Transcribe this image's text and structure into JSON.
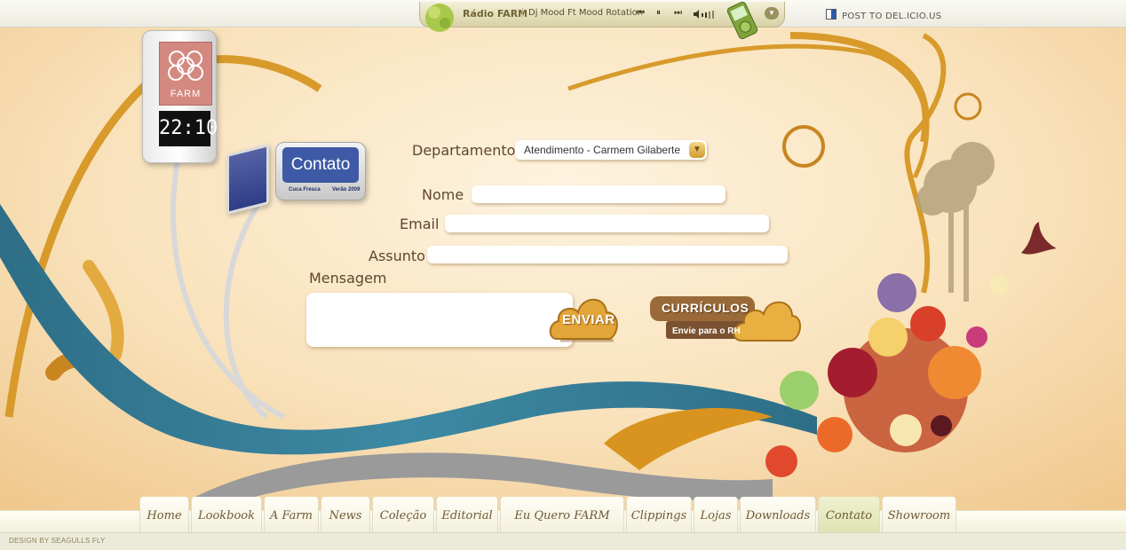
{
  "radio": {
    "title": "Rádio FARM",
    "track": "Dj Mood Ft Mood Rotation",
    "controls": {
      "prev": "⏮",
      "pause": "⏸",
      "next": "⏭"
    }
  },
  "delicious": {
    "label": "POST TO DEL.ICIO.US"
  },
  "kiosk": {
    "brand": "FARM",
    "time": "22:10"
  },
  "sign": {
    "title": "Contato",
    "left_caption": "Cuca Fresca",
    "right_caption": "Verão 2009"
  },
  "form": {
    "departamento_label": "Departamento",
    "departamento_value": "Atendimento - Carmem Gilaberte",
    "nome_label": "Nome",
    "email_label": "Email",
    "assunto_label": "Assunto",
    "mensagem_label": "Mensagem",
    "enviar_label": "ENVIAR",
    "curriculos_title": "CURRÍCULOS",
    "curriculos_sub": "Envie para o RH"
  },
  "nav": {
    "items": [
      "Home",
      "Lookbook",
      "A Farm",
      "News",
      "Coleção",
      "Editorial",
      "Eu Quero FARM",
      "Clippings",
      "Lojas",
      "Downloads",
      "Contato",
      "Showroom"
    ],
    "active": "Contato"
  },
  "footer": {
    "credit": "DESIGN BY SEAGULLS FLY"
  },
  "colors": {
    "accent": "#d89a2a",
    "river": "#2f6f88",
    "sign_blue": "#3e5aa6"
  }
}
